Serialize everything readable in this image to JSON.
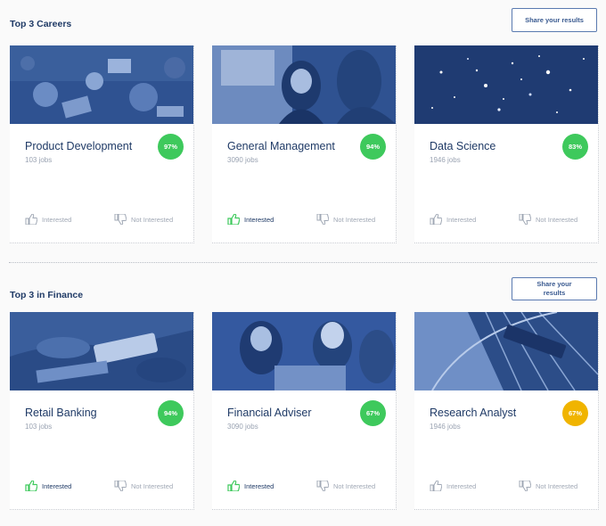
{
  "sections": [
    {
      "title": "Top 3 Careers",
      "share_label": "Share your results",
      "cards": [
        {
          "title": "Product Development",
          "jobs": "103 jobs",
          "score": "97%",
          "score_color": "#3ec95c",
          "interested": "Interested",
          "not_interested": "Not Interested",
          "selected": "none"
        },
        {
          "title": "General Management",
          "jobs": "3090 jobs",
          "score": "94%",
          "score_color": "#3ec95c",
          "interested": "Interested",
          "not_interested": "Not Interested",
          "selected": "interested"
        },
        {
          "title": "Data Science",
          "jobs": "1946 jobs",
          "score": "83%",
          "score_color": "#3ec95c",
          "interested": "Interested",
          "not_interested": "Not Interested",
          "selected": "none"
        }
      ]
    },
    {
      "title": "Top 3 in Finance",
      "share_label": "Share your results",
      "cards": [
        {
          "title": "Retail Banking",
          "jobs": "103 jobs",
          "score": "94%",
          "score_color": "#3ec95c",
          "interested": "Interested",
          "not_interested": "Not Interested",
          "selected": "interested"
        },
        {
          "title": "Financial Adviser",
          "jobs": "3090 jobs",
          "score": "67%",
          "score_color": "#3ec95c",
          "interested": "Interested",
          "not_interested": "Not Interested",
          "selected": "interested"
        },
        {
          "title": "Research Analyst",
          "jobs": "1946 jobs",
          "score": "67%",
          "score_color": "#f0b400",
          "interested": "Interested",
          "not_interested": "Not Interested",
          "selected": "none"
        }
      ]
    }
  ],
  "icons": {
    "interested": "thumbs-up-icon",
    "not_interested": "thumbs-down-icon"
  },
  "colors": {
    "brand": "#1f3a66",
    "match_high": "#3ec95c",
    "match_medium": "#f0b400",
    "image_tint": "#2d4f8e"
  }
}
